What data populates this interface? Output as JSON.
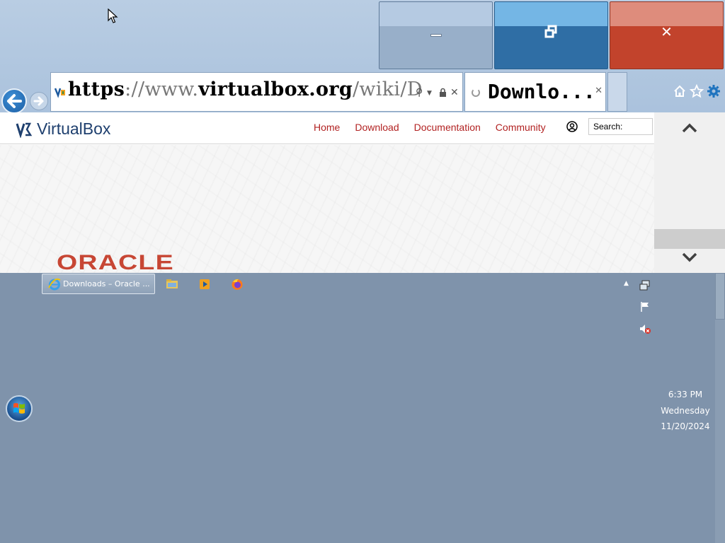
{
  "window": {
    "minimize_label": "minimize",
    "restore_label": "restore",
    "close_label": "close",
    "close_glyph": "✕"
  },
  "address_bar": {
    "url_scheme": "https",
    "url_sep": "://www.",
    "url_host": "virtualbox",
    "url_dot": ".",
    "url_tld": "org",
    "url_path": "/wiki/D",
    "search_icon": "search-icon",
    "lock_icon": "lock-icon"
  },
  "tab": {
    "title": "Downlo...",
    "close_glyph": "✕"
  },
  "page": {
    "logo_text": "VirtualBox",
    "nav": [
      "Home",
      "Download",
      "Documentation",
      "Community"
    ],
    "search_placeholder": "Search:",
    "banner_text": "ORACLE",
    "accent_color": "#b22222"
  },
  "taskbar": {
    "ie_task_label": "Downloads – Oracle ...",
    "clock_time": "6:33 PM",
    "clock_day": "Wednesday",
    "clock_date": "11/20/2024"
  }
}
